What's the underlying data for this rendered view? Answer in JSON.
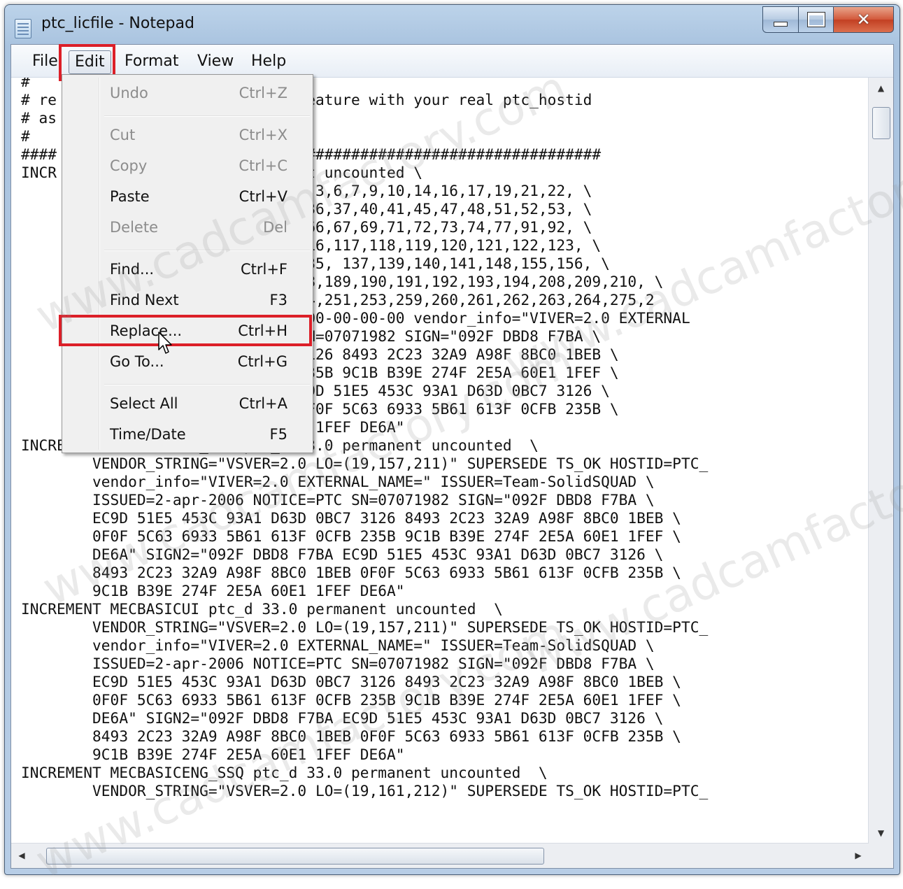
{
  "window": {
    "title": "ptc_licfile - Notepad",
    "caption_buttons": {
      "minimize": "minimize-icon",
      "maximize": "maximize-icon",
      "close": "close-icon"
    }
  },
  "menubar": {
    "file": "File",
    "edit": "Edit",
    "format": "Format",
    "view": "View",
    "help": "Help"
  },
  "edit_menu": {
    "items": [
      {
        "label": "Undo",
        "shortcut": "Ctrl+Z",
        "enabled": false
      },
      {
        "label": "Cut",
        "shortcut": "Ctrl+X",
        "enabled": false
      },
      {
        "label": "Copy",
        "shortcut": "Ctrl+C",
        "enabled": false
      },
      {
        "label": "Paste",
        "shortcut": "Ctrl+V",
        "enabled": true
      },
      {
        "label": "Delete",
        "shortcut": "Del",
        "enabled": false
      },
      {
        "label": "Find...",
        "shortcut": "Ctrl+F",
        "enabled": true
      },
      {
        "label": "Find Next",
        "shortcut": "F3",
        "enabled": true
      },
      {
        "label": "Replace...",
        "shortcut": "Ctrl+H",
        "enabled": true,
        "highlighted": true
      },
      {
        "label": "Go To...",
        "shortcut": "Ctrl+G",
        "enabled": true
      },
      {
        "label": "Select All",
        "shortcut": "Ctrl+A",
        "enabled": true
      },
      {
        "label": "Time/Date",
        "shortcut": "F5",
        "enabled": true
      }
    ]
  },
  "editor": {
    "lines": [
      "####                #############################################",
      "#",
      "# re                0 in every-feature with your real ptc_hostid",
      "# as",
      "#",
      "####                #############################################",
      "INCR                3.0 permanent uncounted \\",
      "                    ER=2.0 LO=(0,3,6,7,9,10,14,16,17,19,21,22, \\",
      "                    31,32,34,35,36,37,40,41,45,47,48,51,52,53, \\",
      "                    61,62,63,65,66,67,69,71,72,73,74,77,91,92, \\",
      "                    06,108,115,116,117,118,119,120,121,122,123, \\",
      "                    31,133,134,135, 137,139,140,141,148,155,156, \\",
      "                    7,168,187,188,189,190,191,192,193,194,208,209,210, \\",
      "                    0,221,222,224,251,253,259,260,261,262,263,264,275,2",
      "                    OSTID=00-00-00-00-00-00 vendor_info=\"VIVER=2.0 EXTERNAL",
      "                    NOTICE=PTC SN=07071982 SIGN=\"092F DBD8 F7BA \\",
      "                   1 D63D 0BC7 3126 8493 2C23 32A9 A98F 8BC0 1BEB \\",
      "                   1 613F 0CFB 235B 9C1B B39E 274F 2E5A 60E1 1FEF \\",
      "                    DBD8 F7BA EC9D 51E5 453C 93A1 D63D 0BC7 3126 \\",
      "                   F 8BC0 1BEB 0F0F 5C63 6933 5B61 613F 0CFB 235B \\",
      "        9C1B B39E 274F 2E5A 60E1 1FEF DE6A\"",
      "INCREMENT MECBASICUI_SSQ ptc_d 33.0 permanent uncounted  \\",
      "        VENDOR_STRING=\"VSVER=2.0 LO=(19,157,211)\" SUPERSEDE TS_OK HOSTID=PTC_",
      "        vendor_info=\"VIVER=2.0 EXTERNAL_NAME=\" ISSUER=Team-SolidSQUAD \\",
      "        ISSUED=2-apr-2006 NOTICE=PTC SN=07071982 SIGN=\"092F DBD8 F7BA \\",
      "        EC9D 51E5 453C 93A1 D63D 0BC7 3126 8493 2C23 32A9 A98F 8BC0 1BEB \\",
      "        0F0F 5C63 6933 5B61 613F 0CFB 235B 9C1B B39E 274F 2E5A 60E1 1FEF \\",
      "        DE6A\" SIGN2=\"092F DBD8 F7BA EC9D 51E5 453C 93A1 D63D 0BC7 3126 \\",
      "        8493 2C23 32A9 A98F 8BC0 1BEB 0F0F 5C63 6933 5B61 613F 0CFB 235B \\",
      "        9C1B B39E 274F 2E5A 60E1 1FEF DE6A\"",
      "INCREMENT MECBASICUI ptc_d 33.0 permanent uncounted  \\",
      "        VENDOR_STRING=\"VSVER=2.0 LO=(19,157,211)\" SUPERSEDE TS_OK HOSTID=PTC_",
      "        vendor_info=\"VIVER=2.0 EXTERNAL_NAME=\" ISSUER=Team-SolidSQUAD \\",
      "        ISSUED=2-apr-2006 NOTICE=PTC SN=07071982 SIGN=\"092F DBD8 F7BA \\",
      "        EC9D 51E5 453C 93A1 D63D 0BC7 3126 8493 2C23 32A9 A98F 8BC0 1BEB \\",
      "        0F0F 5C63 6933 5B61 613F 0CFB 235B 9C1B B39E 274F 2E5A 60E1 1FEF \\",
      "        DE6A\" SIGN2=\"092F DBD8 F7BA EC9D 51E5 453C 93A1 D63D 0BC7 3126 \\",
      "        8493 2C23 32A9 A98F 8BC0 1BEB 0F0F 5C63 6933 5B61 613F 0CFB 235B \\",
      "        9C1B B39E 274F 2E5A 60E1 1FEF DE6A\"",
      "INCREMENT MECBASICENG_SSQ ptc_d 33.0 permanent uncounted  \\",
      "        VENDOR_STRING=\"VSVER=2.0 LO=(19,161,212)\" SUPERSEDE TS_OK HOSTID=PTC_"
    ]
  },
  "watermark": {
    "text": "www.cadcamfactory.com"
  },
  "colors": {
    "highlight_box": "#dc1f28",
    "menu_bg": "#f0f0f0",
    "disabled_text": "#8c8c8c"
  }
}
